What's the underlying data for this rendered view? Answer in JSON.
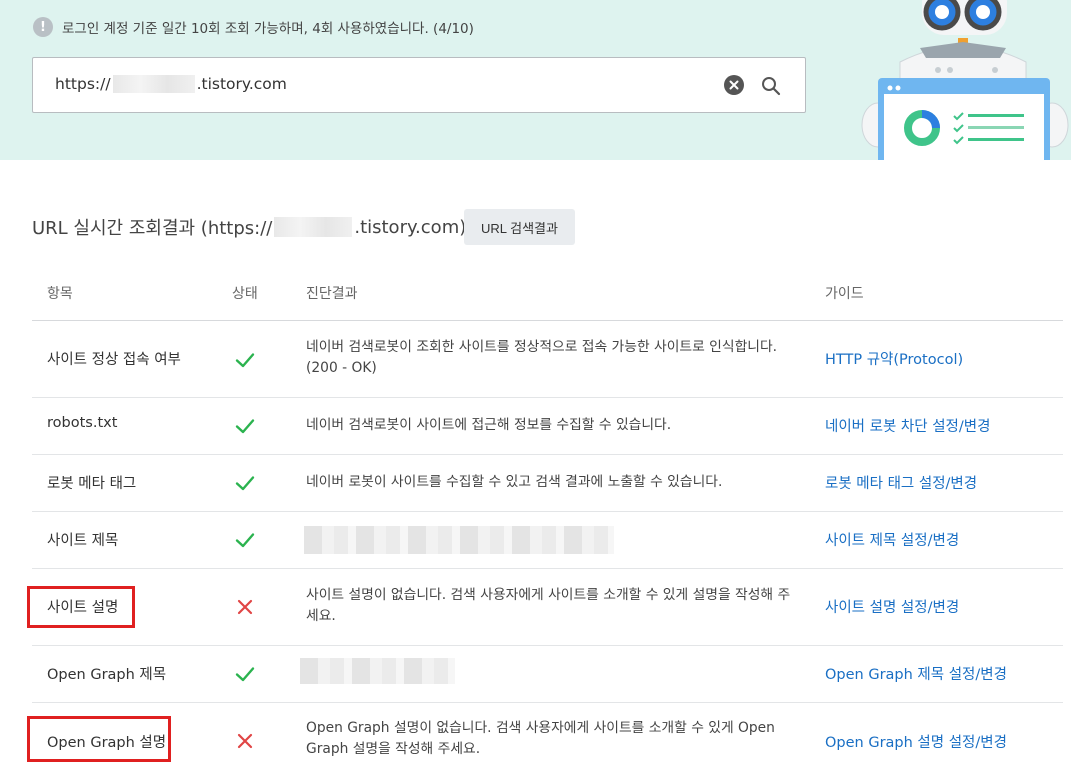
{
  "notice": {
    "icon": "!",
    "text": "로그인 계정 기준 일간 10회 조회 가능하며, 4회 사용하였습니다. (4/10)"
  },
  "search": {
    "prefix": "https://",
    "suffix": ".tistory.com"
  },
  "result": {
    "title_prefix": "URL 실시간 조회결과 (https://",
    "title_suffix": ".tistory.com)",
    "button": "URL 검색결과"
  },
  "table": {
    "headers": {
      "item": "항목",
      "status": "상태",
      "result": "진단결과",
      "guide": "가이드"
    },
    "rows": [
      {
        "item": "사이트 정상 접속 여부",
        "status": "ok",
        "result": "네이버 검색로봇이 조회한 사이트를 정상적으로 접속 가능한 사이트로 인식합니다. (200 - OK)",
        "guide": "HTTP 규약(Protocol)"
      },
      {
        "item": "robots.txt",
        "status": "ok",
        "result": "네이버 검색로봇이 사이트에 접근해 정보를 수집할 수 있습니다.",
        "guide": "네이버 로봇 차단 설정/변경"
      },
      {
        "item": "로봇 메타 태그",
        "status": "ok",
        "result": "네이버 로봇이 사이트를 수집할 수 있고 검색 결과에 노출할 수 있습니다.",
        "guide": "로봇 메타 태그 설정/변경"
      },
      {
        "item": "사이트 제목",
        "status": "ok",
        "result": "",
        "guide": "사이트 제목 설정/변경"
      },
      {
        "item": "사이트 설명",
        "status": "fail",
        "result": "사이트 설명이 없습니다. 검색 사용자에게 사이트를 소개할 수 있게 설명을 작성해 주세요.",
        "guide": "사이트 설명 설정/변경"
      },
      {
        "item": "Open Graph 제목",
        "status": "ok",
        "result": "",
        "guide": "Open Graph 제목 설정/변경"
      },
      {
        "item": "Open Graph 설명",
        "status": "fail",
        "result": "Open Graph 설명이 없습니다. 검색 사용자에게 사이트를 소개할 수 있게 Open Graph 설명을 작성해 주세요.",
        "guide": "Open Graph 설명 설정/변경"
      }
    ]
  },
  "colors": {
    "ok": "#2bb34f",
    "fail": "#e04545",
    "link": "#1a6fc4",
    "highlight": "#e02020",
    "hero_bg": "#def3ef"
  },
  "icons": {
    "ok": "check-icon",
    "fail": "x-icon",
    "clear": "clear-circle-icon",
    "search": "search-icon",
    "notice": "info-circle-icon"
  }
}
